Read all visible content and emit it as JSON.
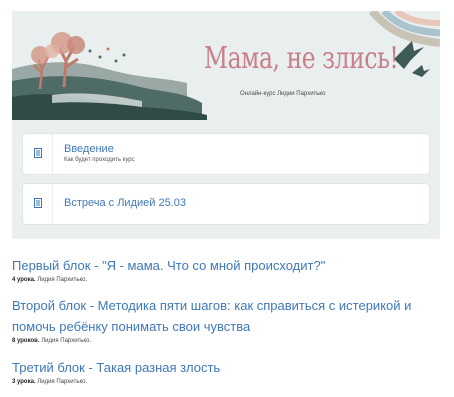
{
  "banner": {
    "title": "Мама, не злись!",
    "subtitle": "Онлайн-курс Лидии Пархитько"
  },
  "lessons": [
    {
      "title": "Введение",
      "description": "Как будет проходить курс",
      "icon": "document-icon"
    },
    {
      "title": "Встреча с Лидией 25.03",
      "description": "",
      "icon": "document-icon"
    }
  ],
  "blocks": [
    {
      "title": "Первый блок - \"Я - мама. Что со мной происходит?\"",
      "count": "4 урока.",
      "author": "Лидия Пархитько."
    },
    {
      "title": "Второй блок - Методика пяти шагов: как справиться с истерикой и помочь ребёнку понимать свои чувства",
      "count": "8 уроков.",
      "author": "Лидия Пархитько."
    },
    {
      "title": "Третий блок - Такая разная злость",
      "count": "3 урока.",
      "author": "Лидия Пархитько."
    }
  ],
  "colors": {
    "link": "#3f78b8",
    "banner_title": "#c97f8a",
    "panel_bg": "#eceff0"
  }
}
